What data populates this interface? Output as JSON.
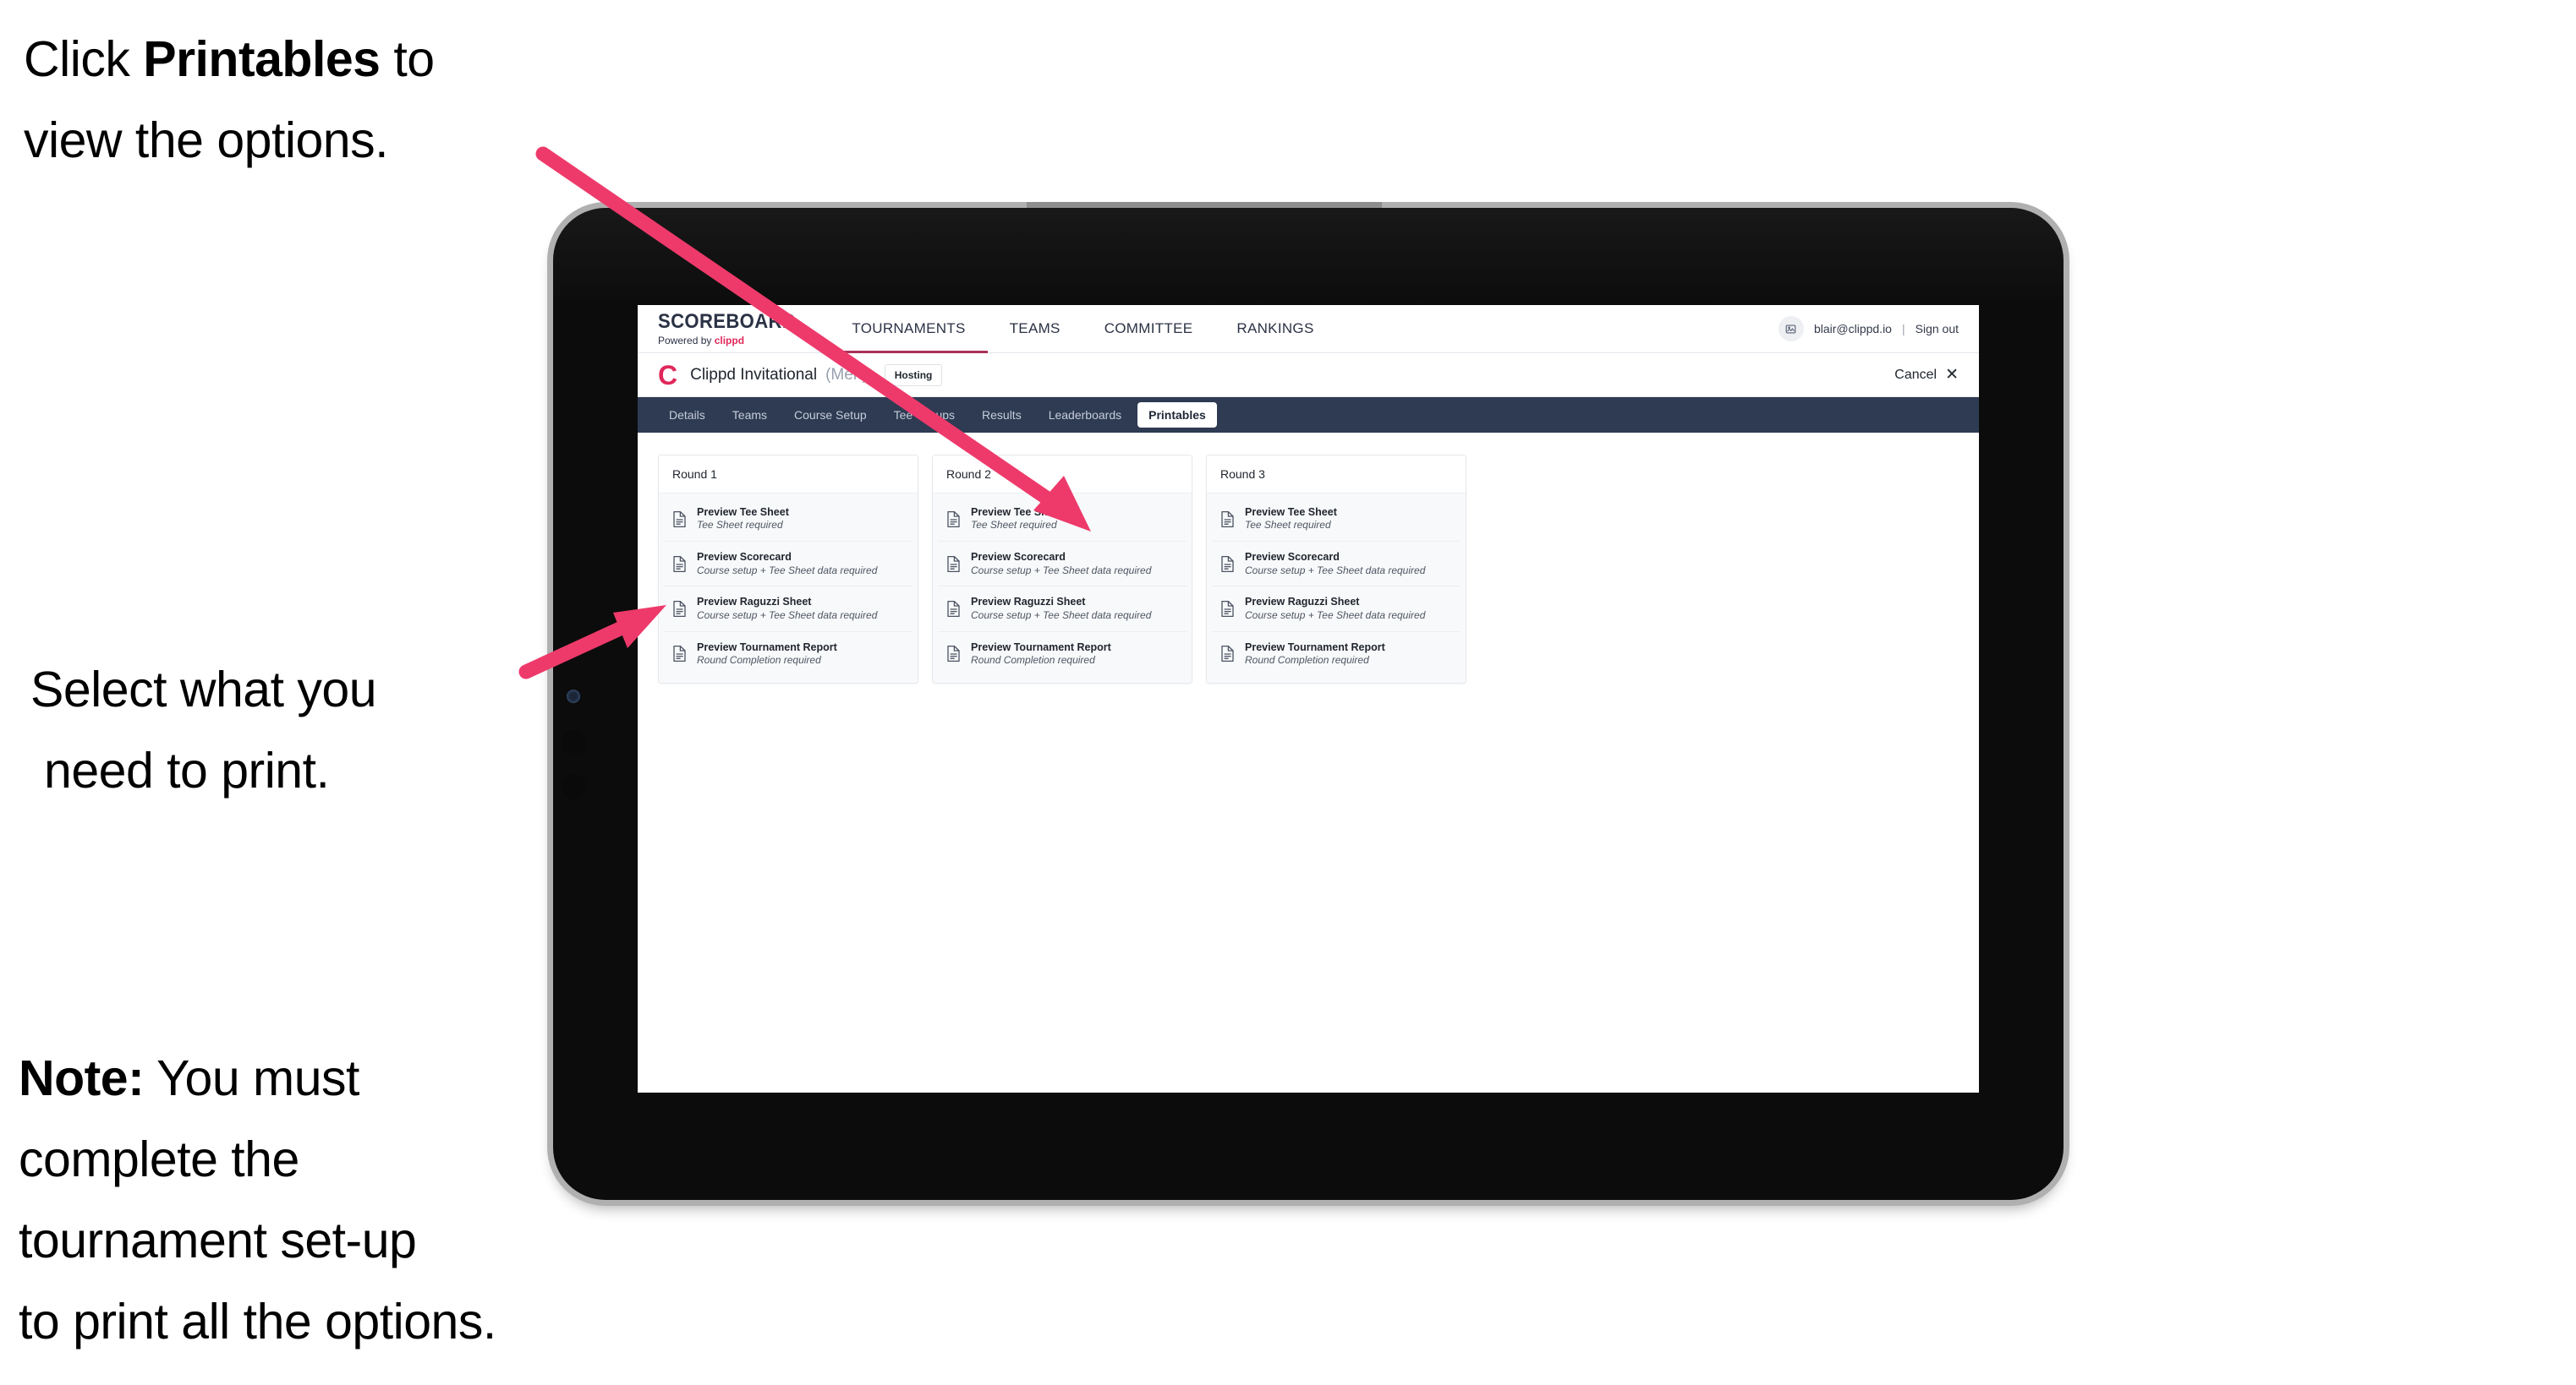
{
  "annotations": {
    "callout_1": {
      "pre": "Click ",
      "bold": "Printables",
      "post": " to",
      "line2": "view the options."
    },
    "callout_2": {
      "line1": "Select what you",
      "line2": "need to print."
    },
    "callout_3": {
      "bold": "Note:",
      "rest": " You must",
      "line2": "complete the",
      "line3": "tournament set-up",
      "line4": "to print all the options."
    },
    "arrow_color": "#ee3a6b"
  },
  "app": {
    "brand": {
      "title": "SCOREBOARD",
      "sub_pre": "Powered by ",
      "sub_brand": "clippd"
    },
    "topnav": {
      "tabs": [
        {
          "label": "TOURNAMENTS",
          "active": true
        },
        {
          "label": "TEAMS",
          "active": false
        },
        {
          "label": "COMMITTEE",
          "active": false
        },
        {
          "label": "RANKINGS",
          "active": false
        }
      ],
      "active_underline_color": "#a8315a",
      "avatar_icon": "user-avatar-icon",
      "user_email": "blair@clippd.io",
      "separator": "|",
      "sign_out_label": "Sign out"
    },
    "tournament_header": {
      "logo_letter": "C",
      "name": "Clippd Invitational",
      "gender": "(Men)",
      "status_badge": "Hosting",
      "cancel_label": "Cancel",
      "cancel_icon": "close-icon"
    },
    "tabbar": {
      "background": "#2e3b53",
      "tabs": [
        {
          "label": "Details",
          "active": false
        },
        {
          "label": "Teams",
          "active": false
        },
        {
          "label": "Course Setup",
          "active": false
        },
        {
          "label": "Tee Groups",
          "active": false
        },
        {
          "label": "Results",
          "active": false
        },
        {
          "label": "Leaderboards",
          "active": false
        },
        {
          "label": "Printables",
          "active": true
        }
      ]
    },
    "printables": {
      "rounds": [
        {
          "title": "Round 1",
          "items": [
            {
              "icon": "document-icon",
              "title": "Preview Tee Sheet",
              "sub": "Tee Sheet required"
            },
            {
              "icon": "document-icon",
              "title": "Preview Scorecard",
              "sub": "Course setup + Tee Sheet data required"
            },
            {
              "icon": "document-icon",
              "title": "Preview Raguzzi Sheet",
              "sub": "Course setup + Tee Sheet data required"
            },
            {
              "icon": "document-icon",
              "title": "Preview Tournament Report",
              "sub": "Round Completion required"
            }
          ]
        },
        {
          "title": "Round 2",
          "items": [
            {
              "icon": "document-icon",
              "title": "Preview Tee Sheet",
              "sub": "Tee Sheet required"
            },
            {
              "icon": "document-icon",
              "title": "Preview Scorecard",
              "sub": "Course setup + Tee Sheet data required"
            },
            {
              "icon": "document-icon",
              "title": "Preview Raguzzi Sheet",
              "sub": "Course setup + Tee Sheet data required"
            },
            {
              "icon": "document-icon",
              "title": "Preview Tournament Report",
              "sub": "Round Completion required"
            }
          ]
        },
        {
          "title": "Round 3",
          "items": [
            {
              "icon": "document-icon",
              "title": "Preview Tee Sheet",
              "sub": "Tee Sheet required"
            },
            {
              "icon": "document-icon",
              "title": "Preview Scorecard",
              "sub": "Course setup + Tee Sheet data required"
            },
            {
              "icon": "document-icon",
              "title": "Preview Raguzzi Sheet",
              "sub": "Course setup + Tee Sheet data required"
            },
            {
              "icon": "document-icon",
              "title": "Preview Tournament Report",
              "sub": "Round Completion required"
            }
          ]
        }
      ]
    }
  },
  "device": {
    "type": "tablet",
    "bezel_color": "#0c0c0c",
    "frame_color": "#b0b0b0",
    "hardware": [
      "front-camera",
      "volume-up-button",
      "volume-down-button"
    ]
  }
}
